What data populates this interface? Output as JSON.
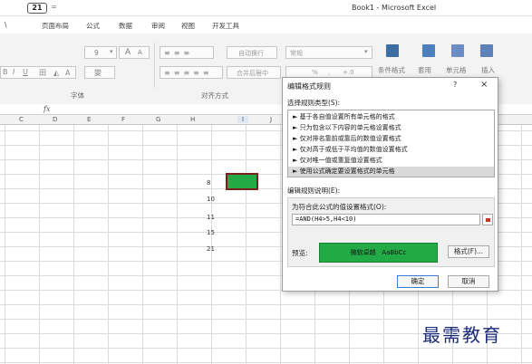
{
  "titlebar": {
    "undo_label": "21",
    "qa_more": "=",
    "title": "Book1 - Microsoft Excel"
  },
  "tabs": [
    "\\",
    "页面布局",
    "公式",
    "数据",
    "审阅",
    "视图",
    "开发工具"
  ],
  "ribbon": {
    "font_size": "9",
    "grow_font": "A",
    "shrink_font": "A",
    "bold": "B",
    "italic": "I",
    "underline": "U",
    "border": "田",
    "phonetic": "變",
    "wrap_text": "自动换行",
    "merge_center": "合并后居中",
    "number_format": "常规",
    "percent": "%",
    "comma": ",",
    "inc_decimal": "+.0",
    "conditional_format": "条件格式",
    "format_table": "套用",
    "cell_styles": "单元格",
    "insert": "插入",
    "group_font": "字体",
    "group_alignment": "对齐方式"
  },
  "formula_bar": {
    "fx": "fx"
  },
  "columns": [
    "C",
    "D",
    "E",
    "F",
    "G",
    "H",
    "I",
    "J"
  ],
  "cells": [
    "8",
    "10",
    "11",
    "15",
    "21"
  ],
  "dialog": {
    "title": "编辑格式规则",
    "help": "?",
    "close": "×",
    "rule_type_label": "选择规则类型(S):",
    "rules": [
      "► 基于各自值设置所有单元格的格式",
      "► 只为包含以下内容的单元格设置格式",
      "► 仅对排名靠前或靠后的数值设置格式",
      "► 仅对高于或低于平均值的数值设置格式",
      "► 仅对唯一值或重复值设置格式",
      "► 使用公式确定要设置格式的单元格"
    ],
    "selected_rule_index": 5,
    "description_label": "编辑规则说明(E):",
    "formula_label": "为符合此公式的值设置格式(O):",
    "formula_value": "=AND(H4>5,H4<10)",
    "preview_label": "预览:",
    "preview_text": "微软卓越   AaBbCc",
    "format_button": "格式(F)...",
    "ok_button": "确定",
    "cancel_button": "取消"
  },
  "colors": {
    "accent_green": "#22aa46",
    "selection_border": "#7a1e1e"
  },
  "watermark": "最需教育"
}
